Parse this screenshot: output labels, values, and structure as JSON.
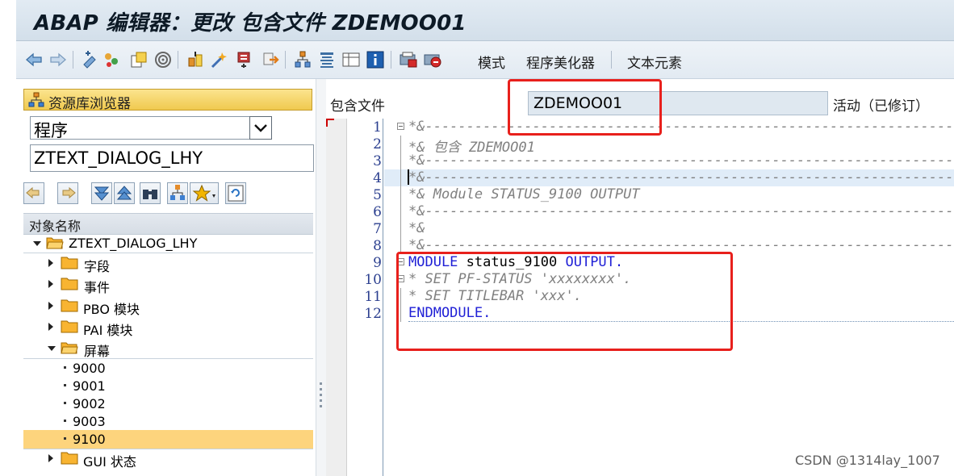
{
  "window": {
    "title": "ABAP 编辑器：更改 包含文件 ZDEMOO01"
  },
  "toolbar": {
    "icons": [
      "back-arrow-icon",
      "forward-arrow-icon",
      "other-object-icon",
      "change-display-icon",
      "active-inactive-icon",
      "check-icon",
      "activate-icon",
      "test-icon",
      "where-used-icon",
      "navigation-icon",
      "object-list-icon",
      "display-icon",
      "info-icon",
      "pattern-icon",
      "pretty-printer-icon"
    ],
    "mode_label": "模式",
    "pretty_printer_label": "程序美化器",
    "text_elements_label": "文本元素"
  },
  "repository": {
    "button_label": "资源库浏览器",
    "object_type": "程序",
    "object_name": "ZTEXT_DIALOG_LHY",
    "tree_header": "对象名称",
    "tree": [
      {
        "label": "ZTEXT_DIALOG_LHY",
        "level": 0,
        "expanded": true
      },
      {
        "label": "字段",
        "level": 1,
        "expanded": false
      },
      {
        "label": "事件",
        "level": 1,
        "expanded": false
      },
      {
        "label": "PBO 模块",
        "level": 1,
        "expanded": false
      },
      {
        "label": "PAI 模块",
        "level": 1,
        "expanded": false
      },
      {
        "label": "屏幕",
        "level": 1,
        "expanded": true
      },
      {
        "label": "9000",
        "level": 2
      },
      {
        "label": "9001",
        "level": 2
      },
      {
        "label": "9002",
        "level": 2
      },
      {
        "label": "9003",
        "level": 2
      },
      {
        "label": "9100",
        "level": 2,
        "selected": true
      },
      {
        "label": "GUI 状态",
        "level": 1,
        "expanded": false
      }
    ]
  },
  "editor": {
    "include_label": "包含文件",
    "include_name": "ZDEMOO01",
    "status": "活动（已修订）",
    "lines": [
      {
        "n": "1",
        "text": "*&---------------------------------------------------------------------*"
      },
      {
        "n": "2",
        "text": "*& 包含               ZDEMOO01"
      },
      {
        "n": "3",
        "text": "*&---------------------------------------------------------------------*"
      },
      {
        "n": "4",
        "text": "*&---------------------------------------------------------------------*"
      },
      {
        "n": "5",
        "text": "*& Module STATUS_9100 OUTPUT"
      },
      {
        "n": "6",
        "text": "*&---------------------------------------------------------------------*"
      },
      {
        "n": "7",
        "text": "*&"
      },
      {
        "n": "8",
        "text": "*&---------------------------------------------------------------------*"
      },
      {
        "n": "9",
        "kw1": "MODULE",
        "mid": " status_9100 ",
        "kw2": "OUTPUT."
      },
      {
        "n": "10",
        "text": "* SET PF-STATUS 'xxxxxxxx'."
      },
      {
        "n": "11",
        "text": "* SET TITLEBAR 'xxx'."
      },
      {
        "n": "12",
        "kw1": "ENDMODULE."
      }
    ]
  },
  "watermark": "CSDN @1314lay_1007"
}
